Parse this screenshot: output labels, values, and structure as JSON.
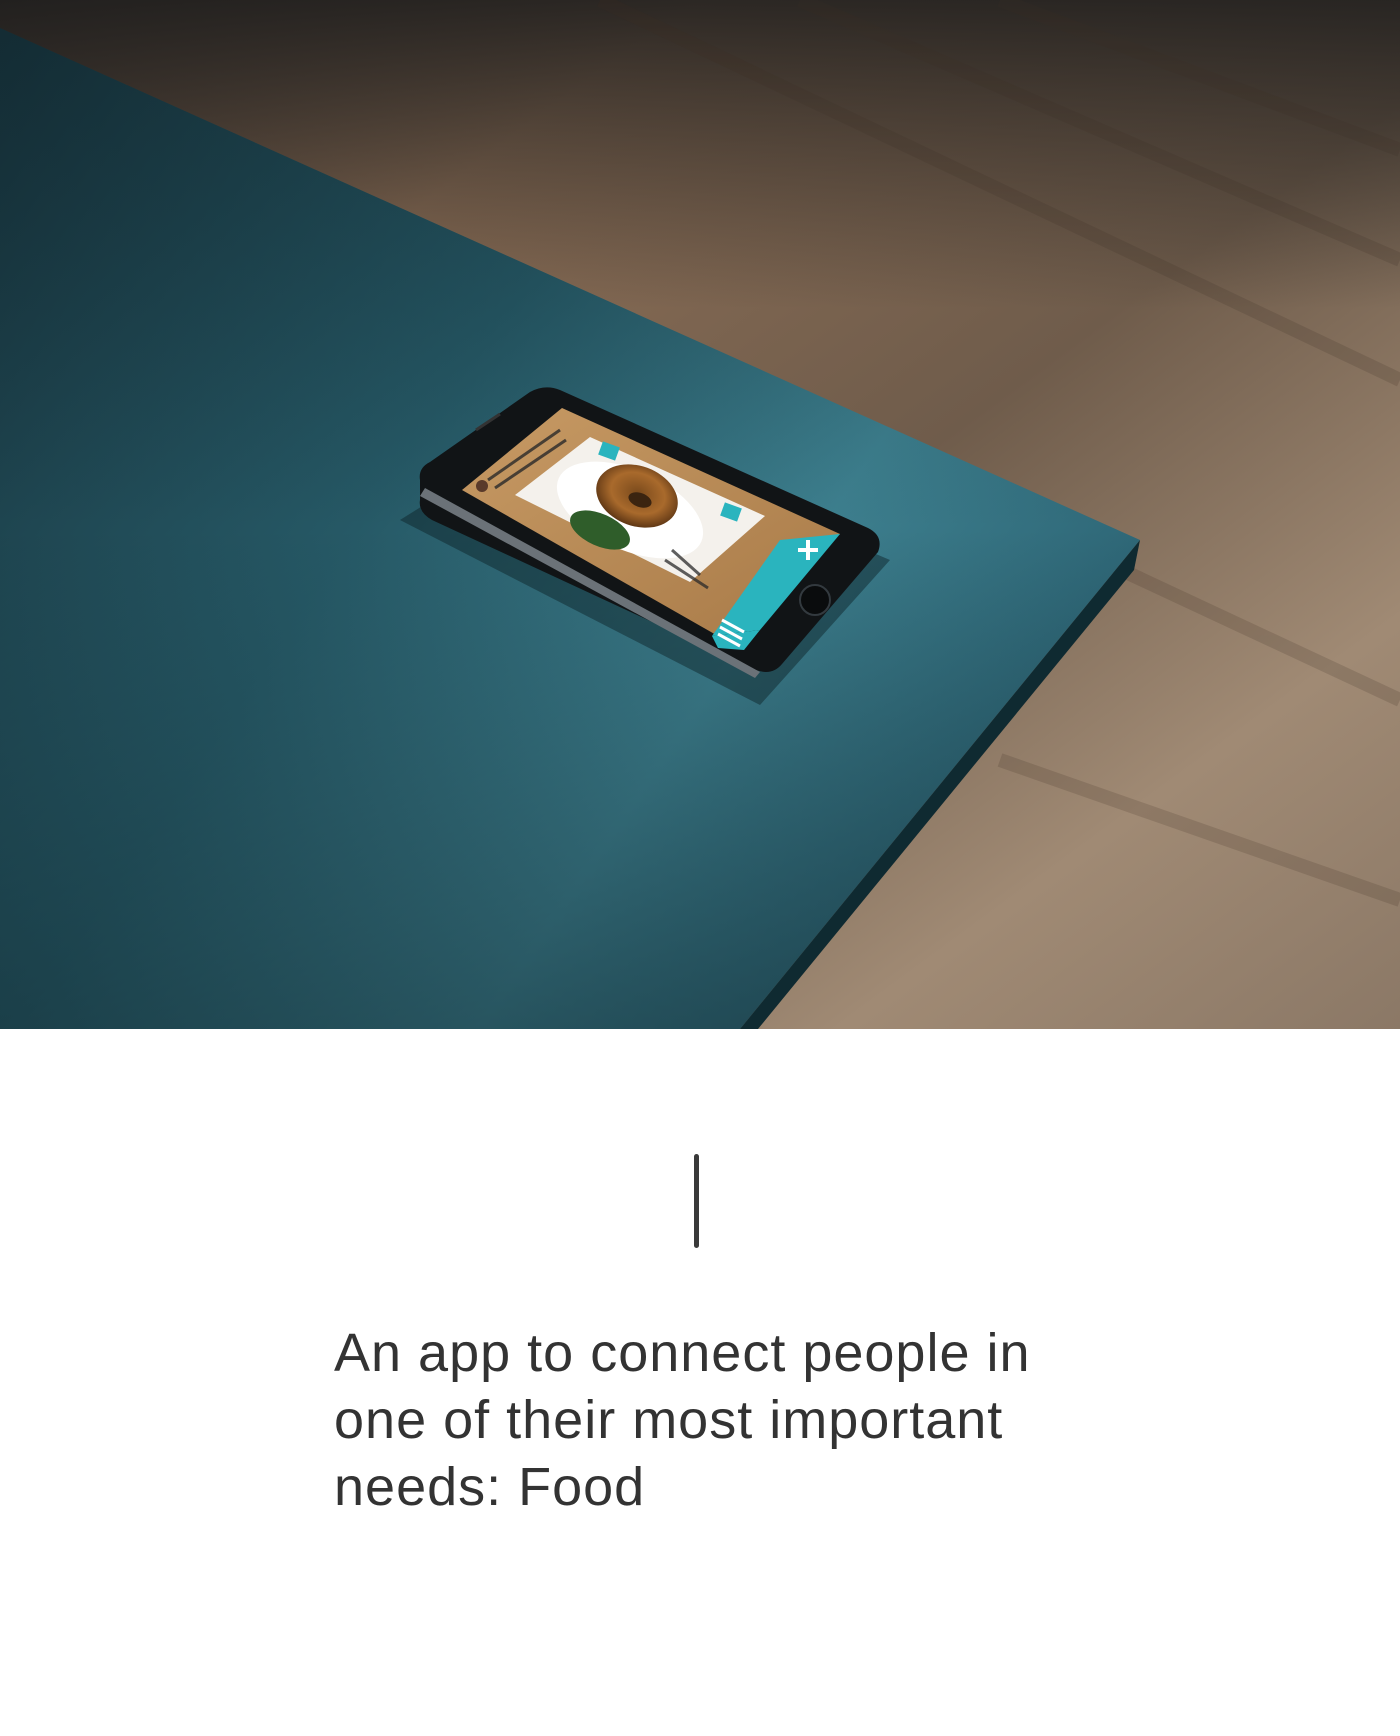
{
  "hero": {
    "alt": "Smartphone showing the food app lying on a teal desk corner over a wooden floor",
    "phone_screen": {
      "food_image": "bagel-sandwich-photo",
      "buttons": [
        "plus-icon",
        "menu-icon",
        "share-icon"
      ]
    }
  },
  "divider": {
    "color": "#3a3a3a"
  },
  "tagline": {
    "text": "An app to connect people in one of their most important needs: Food",
    "color": "#333333"
  },
  "colors": {
    "desk": "#1f4d57",
    "floor": "#6e5a48",
    "accent": "#2ab4be",
    "background": "#ffffff"
  }
}
